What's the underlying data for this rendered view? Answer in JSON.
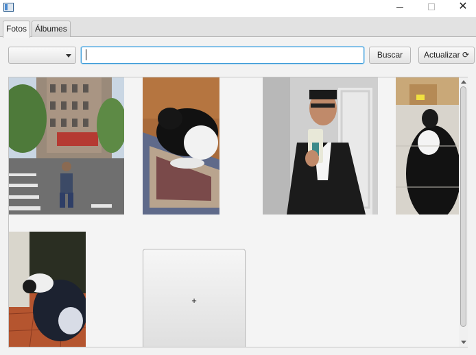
{
  "window": {
    "controls": {
      "minimize_icon": "minimize-icon",
      "maximize_icon": "maximize-icon",
      "close_icon": "close-icon",
      "close_glyph": "✕"
    }
  },
  "tabs": [
    {
      "label": "Fotos",
      "active": true
    },
    {
      "label": "Álbumes",
      "active": false
    }
  ],
  "toolbar": {
    "filter_combo_value": "",
    "search_value": "",
    "search_label": "Buscar",
    "refresh_label": "Actualizar ⟳"
  },
  "gallery": {
    "photos": [
      {
        "subject": "Man kneeling on a city street crosswalk in front of brick apartment buildings"
      },
      {
        "subject": "Black and white dog sleeping on a patterned rug"
      },
      {
        "subject": "Man in tuxedo taking a mirror selfie with a phone"
      },
      {
        "subject": "Black and white dog seen from above on a tiled floor"
      },
      {
        "subject": "Black and white dog sniffing a corner on a terracotta floor"
      }
    ],
    "add_tile_label": "+"
  }
}
